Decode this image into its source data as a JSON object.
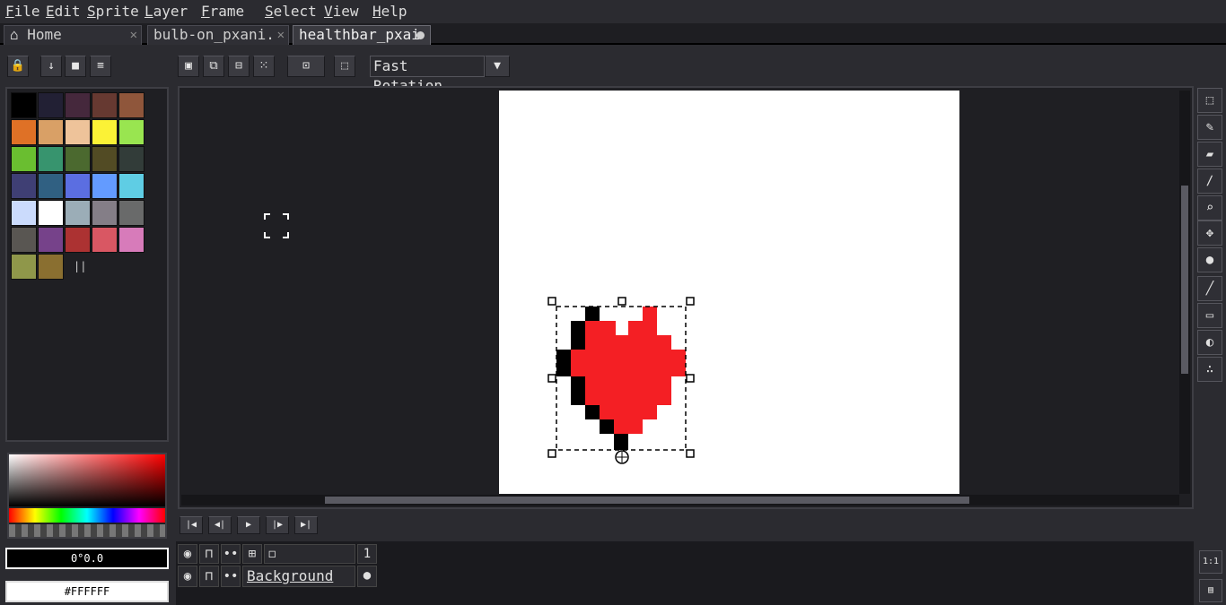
{
  "menu": [
    {
      "first": "F",
      "rest": "ile"
    },
    {
      "first": "E",
      "rest": "dit"
    },
    {
      "first": "S",
      "rest": "prite"
    },
    {
      "first": "L",
      "rest": "ayer"
    },
    {
      "first": "F",
      "rest": "rame"
    },
    {
      "first": "S",
      "rest": "elect"
    },
    {
      "first": "V",
      "rest": "iew"
    },
    {
      "first": "H",
      "rest": "elp"
    }
  ],
  "tabs": {
    "home": "Home",
    "bulb": "bulb-on_pxani.",
    "health": "healthbar_pxai"
  },
  "toolbar": {
    "rotation_mode": "Fast Rotation"
  },
  "palette_colors": [
    "#000000",
    "#222034",
    "#45283c",
    "#663931",
    "#8f563b",
    "#df7126",
    "#d9a066",
    "#eec39a",
    "#fbf236",
    "#99e550",
    "#6abe30",
    "#37946e",
    "#4b692f",
    "#524b24",
    "#323c39",
    "#3f3f74",
    "#306082",
    "#5b6ee1",
    "#639bff",
    "#5fcde4",
    "#cbdbfc",
    "#ffffff",
    "#9badb7",
    "#847e87",
    "#696a6a",
    "#595652",
    "#76428a",
    "#ac3232",
    "#d95763",
    "#d77bba",
    "#8f974a",
    "#8a6f30"
  ],
  "color_display": {
    "hsv_readout": "0°0.0",
    "hex_value": "#FFFFFF"
  },
  "timeline": {
    "frame_number": "1",
    "layer_name": "Background"
  }
}
